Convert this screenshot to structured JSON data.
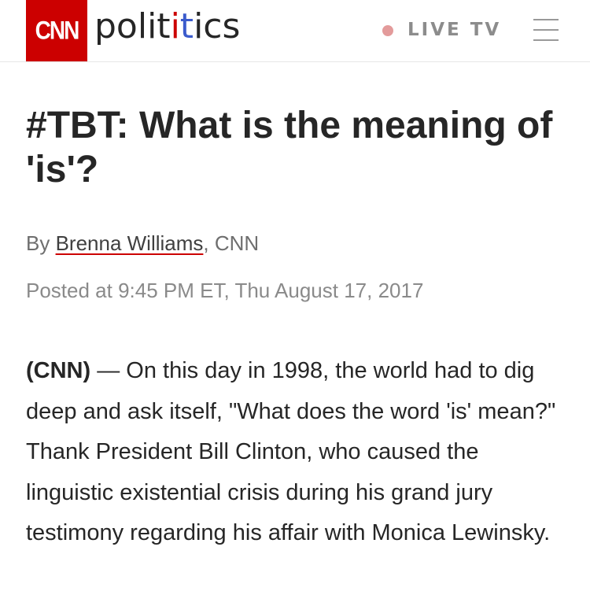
{
  "header": {
    "logo_text": "CNN",
    "section_parts": [
      "polit",
      "i",
      "t",
      "ics"
    ],
    "live_label": "LIVE TV",
    "colors": {
      "brand_red": "#cc0000",
      "live_dot": "#e39b9b",
      "accent_blue": "#3b5bcc"
    },
    "menu_icon": "hamburger-menu-icon"
  },
  "article": {
    "headline": "#TBT: What is the meaning of 'is'?",
    "byline_prefix": "By ",
    "author": "Brenna Williams",
    "byline_suffix": ", CNN",
    "timestamp": "Posted at 9:45 PM ET, Thu August 17, 2017",
    "dateline": "(CNN)",
    "body": " — On this day in 1998, the world had to dig deep and ask itself, \"What does the word 'is' mean?\" Thank President Bill Clinton, who caused the linguistic existential crisis during his grand jury testimony regarding his affair with Monica Lewinsky."
  }
}
